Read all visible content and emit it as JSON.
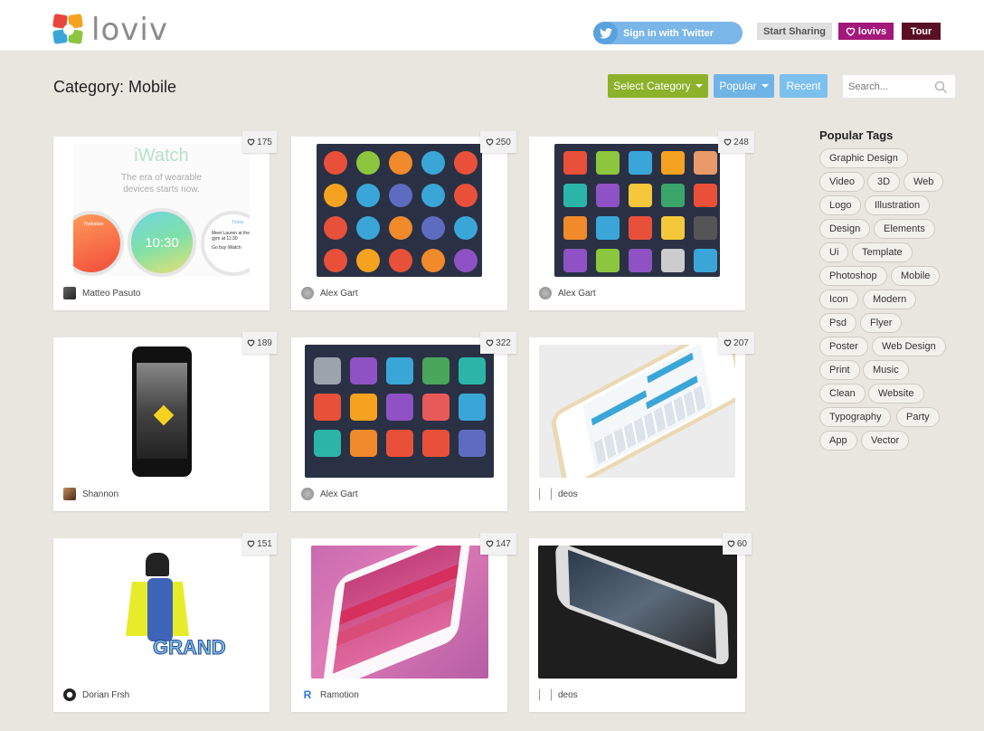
{
  "header": {
    "logo_text": "loviv",
    "twitter_label": "Sign in with Twitter",
    "start_sharing_label": "Start Sharing",
    "lovivs_label": "lovivs",
    "tour_label": "Tour"
  },
  "page": {
    "title": "Category: Mobile",
    "select_category_label": "Select Category",
    "popular_label": "Popular",
    "recent_label": "Recent",
    "search_placeholder": "Search..."
  },
  "cards": [
    {
      "likes": "175",
      "author": "Matteo Pasuto"
    },
    {
      "likes": "250",
      "author": "Alex Gart"
    },
    {
      "likes": "248",
      "author": "Alex Gart"
    },
    {
      "likes": "189",
      "author": "Shannon"
    },
    {
      "likes": "322",
      "author": "Alex Gart"
    },
    {
      "likes": "207",
      "author": "deos"
    },
    {
      "likes": "151",
      "author": "Dorian Frsh"
    },
    {
      "likes": "147",
      "author": "Ramotion"
    },
    {
      "likes": "60",
      "author": "deos"
    }
  ],
  "thumb_text": {
    "iwatch_title": "iWatch",
    "iwatch_sub1": "The era of wearable",
    "iwatch_sub2": "devices starts now.",
    "iwatch_time": "10:30",
    "iwatch_today": "Today",
    "iwatch_meet": "Meet Lauren at the gym at 11:30",
    "iwatch_buy": "Go buy iWatch",
    "iwatch_hydration": "Hydration",
    "grand_text": "GRAND"
  },
  "sidebar": {
    "title": "Popular Tags",
    "tags": [
      "Graphic Design",
      "Video",
      "3D",
      "Web",
      "Logo",
      "Illustration",
      "Design",
      "Elements",
      "Ui",
      "Template",
      "Photoshop",
      "Mobile",
      "Icon",
      "Modern",
      "Psd",
      "Flyer",
      "Poster",
      "Web Design",
      "Print",
      "Music",
      "Clean",
      "Website",
      "Typography",
      "Party",
      "App",
      "Vector"
    ]
  },
  "colors": {
    "background": "#e9e6e0",
    "twitter": "#7ab6e8",
    "select_category": "#8cb12a",
    "popular": "#6fb4e6",
    "recent": "#7cc0ee",
    "lovivs": "#a3187a",
    "tour": "#5a1024"
  },
  "icons": [
    "twitter-icon",
    "heart-icon",
    "search-icon",
    "caret-down-icon"
  ]
}
